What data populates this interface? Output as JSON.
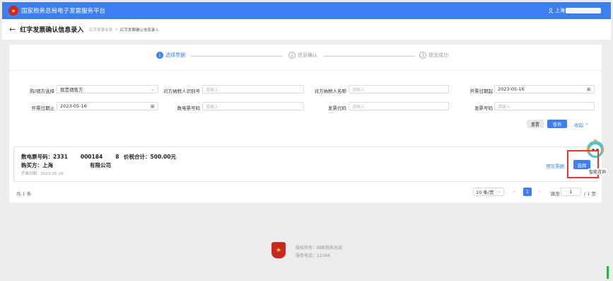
{
  "app": {
    "title": "国家税务总局电子发票服务平台",
    "logo_icon": "tax-emblem",
    "user_label": "上海"
  },
  "header": {
    "back_icon": "←",
    "page_title": "红字发票确认信息录入",
    "breadcrumb": [
      "红字发票业务",
      "红字发票确认信息录入"
    ]
  },
  "steps": [
    {
      "num": "1",
      "label": "选择票据",
      "active": true
    },
    {
      "num": "2",
      "label": "信息确认",
      "active": false
    },
    {
      "num": "3",
      "label": "提交成功",
      "active": false
    }
  ],
  "filters": {
    "buyer_seller_label": "购/销方选择",
    "buyer_seller_value": "我是销售方",
    "counterparty_tax_id_label": "对方纳税人识别号",
    "counterparty_tax_id_placeholder": "请输入",
    "counterparty_name_label": "对方纳税人名称",
    "counterparty_name_placeholder": "请输入",
    "invoice_date_from_label": "开票日期起",
    "invoice_date_from_value": "2023-05-16",
    "invoice_date_to_label": "开票日期止",
    "invoice_date_to_value": "2023-05-16",
    "einvoice_no_label": "数电票号码",
    "einvoice_no_placeholder": "请输入",
    "invoice_code_label": "发票代码",
    "invoice_code_placeholder": "请输入",
    "invoice_no_label": "发票号码",
    "invoice_no_placeholder": "请输入",
    "reset_label": "重置",
    "query_label": "查询",
    "collapse_label": "收起 ^"
  },
  "result": {
    "einvoice_label": "数电票号码：",
    "einvoice_part1": "2331",
    "einvoice_part2": "000184",
    "einvoice_part3": "8",
    "total_label": "价税合计：",
    "total_value": "500.00元",
    "buyer_label": "购买方：",
    "buyer_part1": "上海",
    "buyer_part2": "有限公司",
    "date_label": "开票日期：",
    "date_value": "2023-05-16",
    "preview_label": "预览票据",
    "select_label": "选择"
  },
  "assistant": {
    "label": "智能咨询",
    "icon": "robot-icon"
  },
  "pagination": {
    "total_text": "共 1 条",
    "page_size": "10 条/页",
    "current_page": "1",
    "goto_label": "跳至",
    "goto_value": "1",
    "pages_text": "/ 1 页"
  },
  "footer": {
    "copyright": "版权所有：国家税务总局",
    "hotline": "服务电话：12366"
  },
  "colors": {
    "primary": "#3d7ff2",
    "highlight": "#e53935",
    "emblem": "#c8281e"
  }
}
